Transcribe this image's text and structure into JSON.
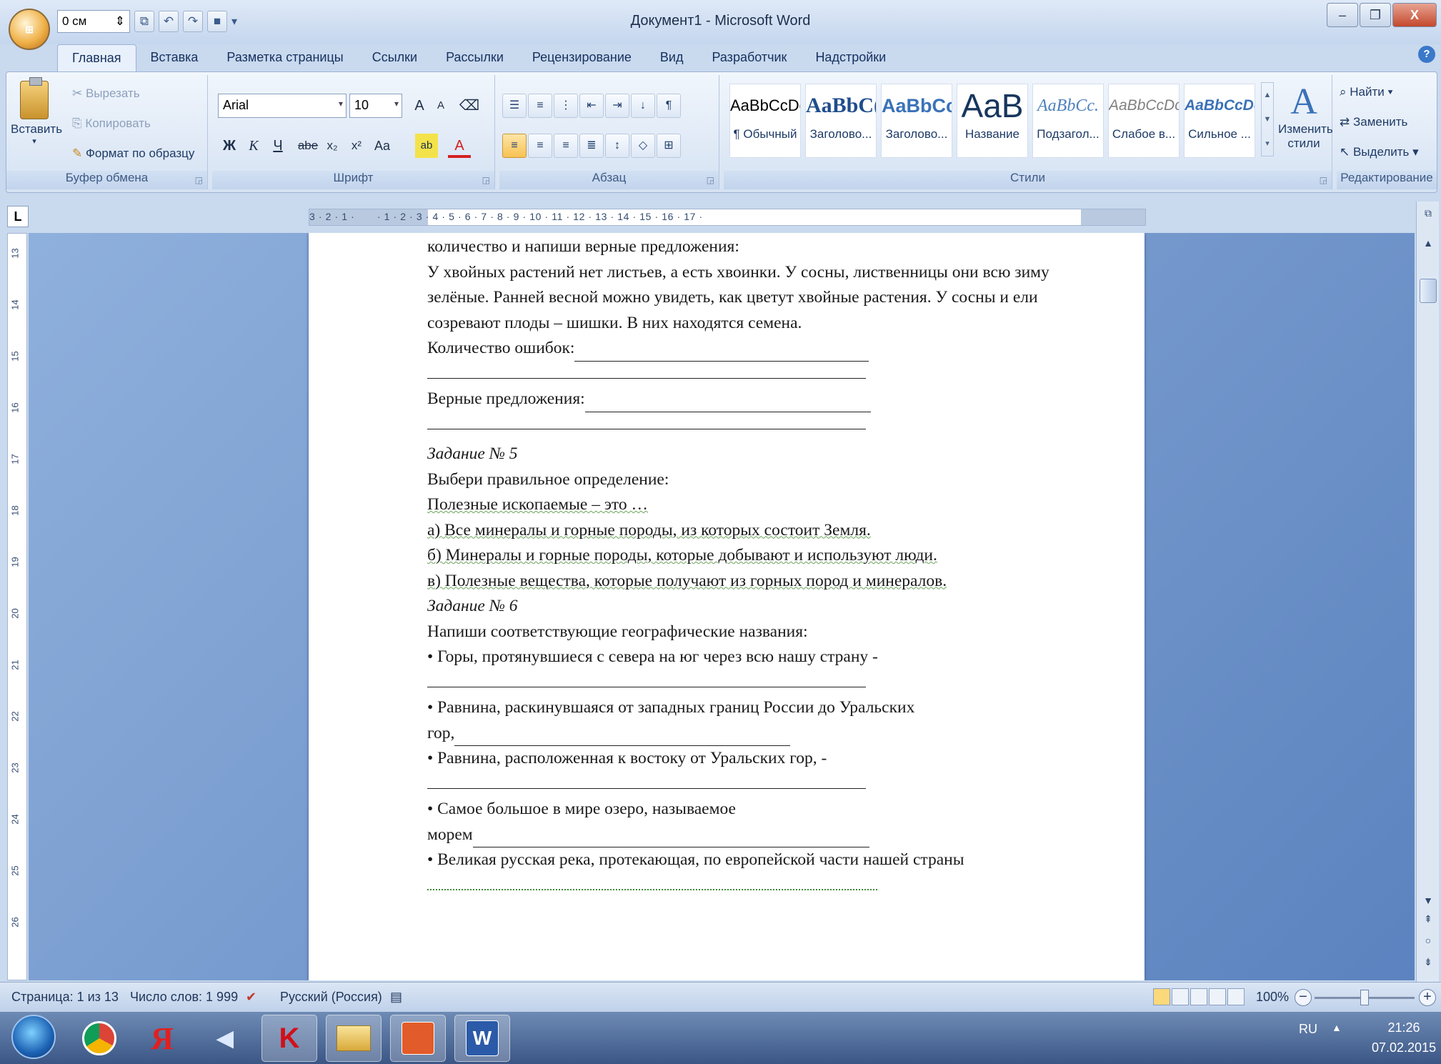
{
  "window": {
    "title": "Документ1 - Microsoft Word",
    "office_button": "Office"
  },
  "qat": {
    "indent_value": "0 см",
    "customize": "▾"
  },
  "window_buttons": {
    "minimize": "–",
    "restore": "❐",
    "close": "X"
  },
  "tabs": [
    "Главная",
    "Вставка",
    "Разметка страницы",
    "Ссылки",
    "Рассылки",
    "Рецензирование",
    "Вид",
    "Разработчик",
    "Надстройки"
  ],
  "active_tab": "Главная",
  "clipboard": {
    "paste": "Вставить",
    "cut": "Вырезать",
    "copy": "Копировать",
    "format_painter": "Формат по образцу",
    "label": "Буфер обмена"
  },
  "font": {
    "name": "Arial",
    "size": "10",
    "label": "Шрифт",
    "bold": "Ж",
    "italic": "К",
    "underline": "Ч",
    "strike": "abe",
    "sub": "x₂",
    "sup": "x²",
    "case": "Aa",
    "grow": "A",
    "shrink": "A"
  },
  "paragraph": {
    "label": "Абзац"
  },
  "styles": {
    "label": "Стили",
    "items": [
      {
        "sample": "AaBbCcDc",
        "name": "¶ Обычный"
      },
      {
        "sample": "AaBbC(",
        "name": "Заголово..."
      },
      {
        "sample": "AaBbCc",
        "name": "Заголово..."
      },
      {
        "sample": "AaB",
        "name": "Название"
      },
      {
        "sample": "AaBbCc.",
        "name": "Подзагол..."
      },
      {
        "sample": "AaBbCcDc",
        "name": "Слабое в..."
      },
      {
        "sample": "AaBbCcDc",
        "name": "Сильное ..."
      }
    ],
    "change": "Изменить стили"
  },
  "editing": {
    "find": "Найти",
    "replace": "Заменить",
    "select": "Выделить",
    "label": "Редактирование"
  },
  "ruler": {
    "corner": "L",
    "marks": "3 · 2 · 1 ·       · 1 · 2 · 3 · 4 · 5 · 6 · 7 · 8 · 9 · 10 · 11 · 12 · 13 · 14 · 15 · 16 · 17 ·",
    "vertical": [
      "13",
      "14",
      "15",
      "16",
      "17",
      "18",
      "19",
      "20",
      "21",
      "22",
      "23",
      "24",
      "25",
      "26"
    ]
  },
  "document": {
    "l1": "количество и напиши верные предложения:",
    "l2": "У хвойных растений нет листьев, а есть хвоинки. У сосны, лиственницы они всю зиму",
    "l3": "зелёные. Ранней весной можно увидеть, как цветут хвойные растения. У сосны и ели",
    "l4": "созревают плоды – шишки. В них находятся семена.",
    "l5": "Количество ошибок:",
    "l7": "Верные предложения:",
    "l9": "Задание № 5",
    "l10": "Выбери правильное определение:",
    "l11": "Полезные ископаемые – это …",
    "l12": "а) Все минералы и горные породы, из которых состоит Земля.",
    "l13": "б) Минералы и горные породы, которые добывают и используют люди.",
    "l14": "в) Полезные вещества, которые получают из горных пород и минералов.",
    "l15": "Задание № 6",
    "l16": "Напиши соответствующие географические названия:",
    "l17": "• Горы, протянувшиеся с севера на юг через всю нашу страну -",
    "l19": "• Равнина, раскинувшаяся от западных границ России до Уральских",
    "l20": "гор,",
    "l21": "• Равнина, расположенная к востоку от Уральских гор, -",
    "l23": "• Самое большое в мире озеро, называемое",
    "l24": "морем",
    "l25": "• Великая русская река, протекающая, по европейской части нашей страны"
  },
  "status": {
    "page": "Страница: 1 из 13",
    "words": "Число слов: 1 999",
    "language": "Русский (Россия)",
    "zoom": "100%"
  },
  "taskbar": {
    "lang": "RU",
    "time": "21:26",
    "date": "07.02.2015"
  }
}
